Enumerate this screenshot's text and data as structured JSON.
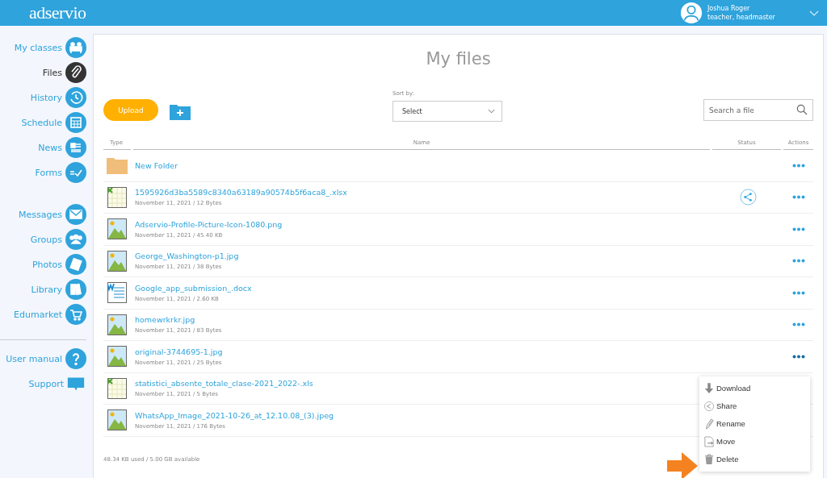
{
  "header": {
    "logo": "adservio",
    "user": {
      "name": "Joshua Roger",
      "role": "teacher, headmaster"
    }
  },
  "sidebar": {
    "sections": [
      {
        "items": [
          {
            "label": "My classes",
            "selected": false
          },
          {
            "label": "Files",
            "selected": true
          },
          {
            "label": "History",
            "selected": false
          },
          {
            "label": "Schedule",
            "selected": false
          },
          {
            "label": "News",
            "selected": false
          },
          {
            "label": "Forms",
            "selected": false
          }
        ]
      },
      {
        "items": [
          {
            "label": "Messages",
            "selected": false
          },
          {
            "label": "Groups",
            "selected": false
          },
          {
            "label": "Photos",
            "selected": false
          },
          {
            "label": "Library",
            "selected": false
          },
          {
            "label": "Edumarket",
            "selected": false
          }
        ]
      },
      {
        "items": [
          {
            "label": "User manual",
            "selected": false
          },
          {
            "label": "Support",
            "selected": false
          }
        ]
      }
    ]
  },
  "page": {
    "title": "My files"
  },
  "toolbar": {
    "upload": "Upload",
    "sort_label": "Sort by:",
    "sort_value": "Select",
    "search": {
      "placeholder": "Search a file"
    }
  },
  "table": {
    "columns": [
      "Type",
      "Name",
      "Status",
      "Actions"
    ],
    "rows": [
      {
        "kind": "folder",
        "name": "New Folder",
        "shared": false,
        "menu_open": false
      },
      {
        "kind": "excel",
        "name": "1595926d3ba5589c8340a63189a90574b5f6aca8_.xlsx",
        "meta": "November 11, 2021 / 12 Bytes",
        "shared": true,
        "menu_open": false
      },
      {
        "kind": "image",
        "name": "Adservio-Profile-Picture-Icon-1080.png",
        "meta": "November 11, 2021 / 45.40 KB",
        "shared": false,
        "menu_open": false
      },
      {
        "kind": "image",
        "name": "George_Washington-p1.jpg",
        "meta": "November 11, 2021 / 38 Bytes",
        "shared": false,
        "menu_open": false
      },
      {
        "kind": "word",
        "name": "Google_app_submission_.docx",
        "meta": "November 11, 2021 / 2.60 KB",
        "shared": false,
        "menu_open": false
      },
      {
        "kind": "image",
        "name": "homewrkrkr.jpg",
        "meta": "November 11, 2021 / 83 Bytes",
        "shared": false,
        "menu_open": false
      },
      {
        "kind": "image",
        "name": "original-3744695-1.jpg",
        "meta": "November 11, 2021 / 25 Bytes",
        "shared": false,
        "menu_open": true
      },
      {
        "kind": "excel",
        "name": "statistici_absente_totale_clase-2021_2022-.xls",
        "meta": "November 11, 2021 / 5 Bytes",
        "menu_open": false
      },
      {
        "kind": "image",
        "name": "WhatsApp_Image_2021-10-26_at_12.10.08_(3).jpeg",
        "meta": "November 11, 2021 / 176 Bytes",
        "menu_open": false
      }
    ]
  },
  "actions_menu": {
    "items": [
      {
        "kind": "download",
        "label": "Download"
      },
      {
        "kind": "share",
        "label": "Share"
      },
      {
        "kind": "rename",
        "label": "Rename"
      },
      {
        "kind": "move",
        "label": "Move"
      },
      {
        "kind": "delete",
        "label": "Delete"
      }
    ]
  },
  "footer": {
    "storage": "48.34 KB used / 5.00 GB available"
  }
}
